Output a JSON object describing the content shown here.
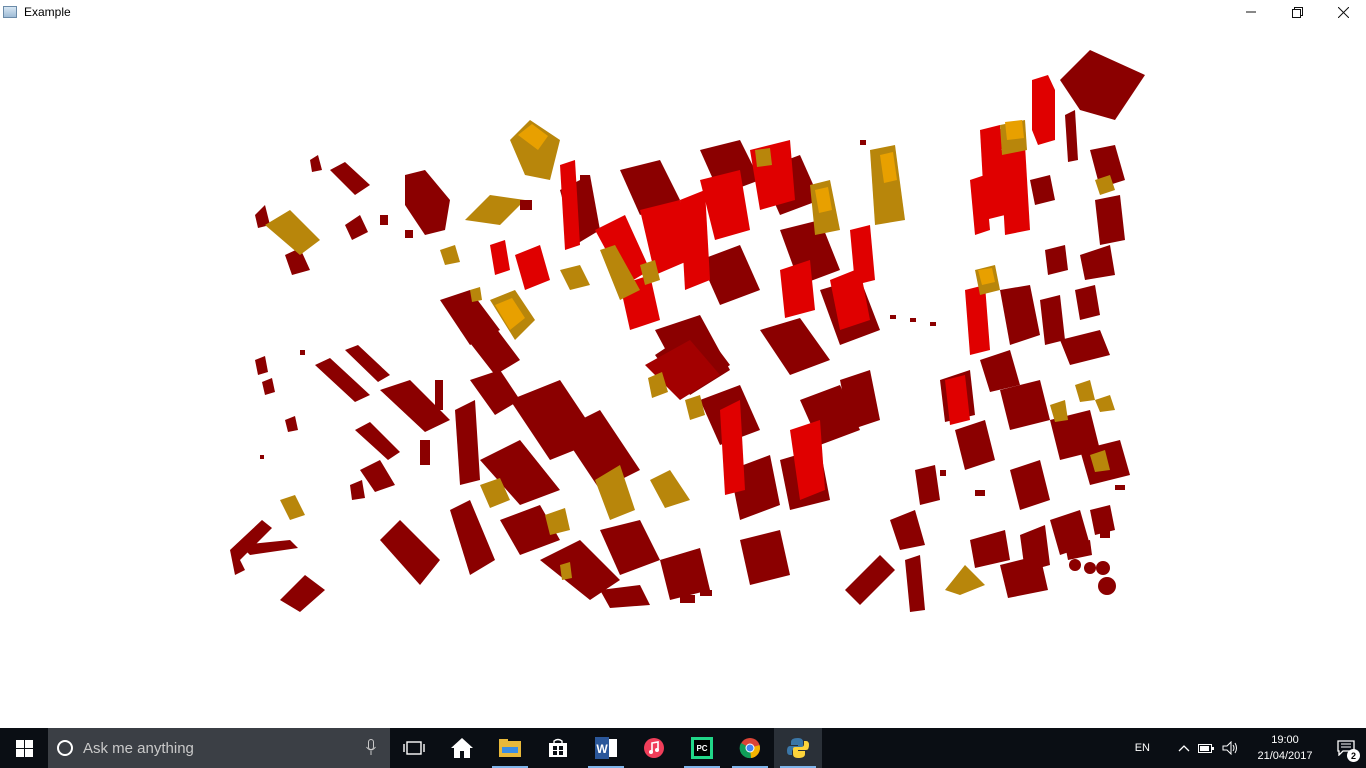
{
  "window": {
    "title": "Example",
    "controls": [
      "minimize-icon",
      "restore-icon",
      "close-icon"
    ]
  },
  "scene": {
    "colors": {
      "building": "#8b0000",
      "building_lit": "#e00000",
      "building_bright": "#ff1a1a",
      "highlight": "#b8860b",
      "highlight_top": "#e8a000"
    }
  },
  "taskbar": {
    "search_placeholder": "Ask me anything",
    "apps": [
      {
        "name": "task-view-icon"
      },
      {
        "name": "edge-home-icon"
      },
      {
        "name": "file-explorer-icon"
      },
      {
        "name": "store-icon"
      },
      {
        "name": "word-icon"
      },
      {
        "name": "itunes-icon"
      },
      {
        "name": "pycharm-icon"
      },
      {
        "name": "chrome-icon"
      },
      {
        "name": "python-icon"
      }
    ],
    "tray": {
      "language": "EN",
      "time": "19:00",
      "date": "21/04/2017",
      "notification_count": "2"
    }
  }
}
